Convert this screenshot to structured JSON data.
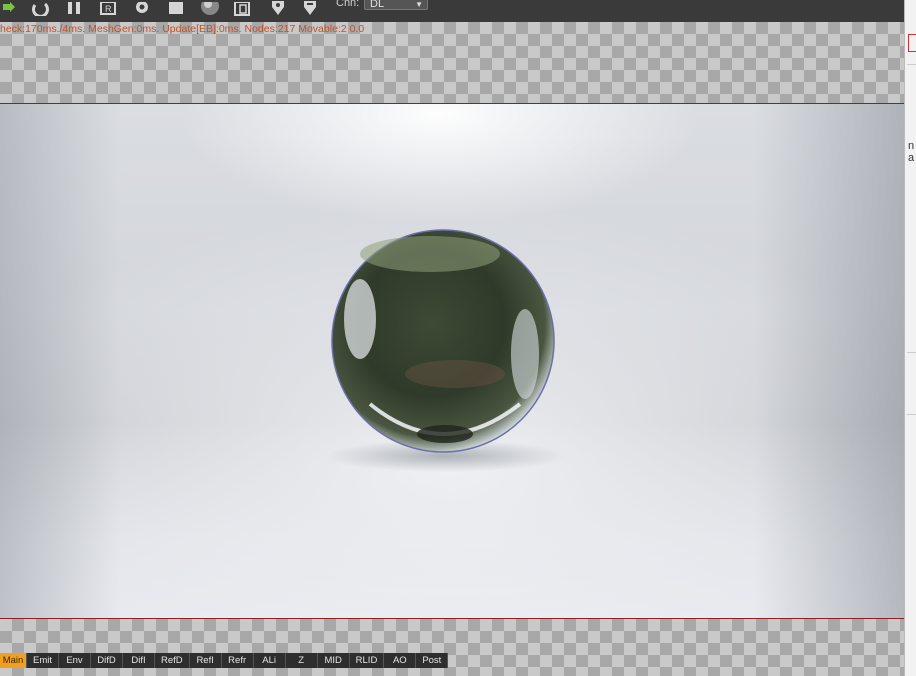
{
  "toolbar": {
    "icons": [
      "refresh-icon",
      "reload-icon",
      "pause-icon",
      "region-icon",
      "settings-icon",
      "stop-icon",
      "material-ball-icon",
      "clipboard-icon",
      "pin-icon",
      "pin-alt-icon"
    ],
    "channel_label": "Chn:",
    "channel_value": "DL"
  },
  "status": {
    "text": "heck:170ms./4ms. MeshGen:0ms. Update[EB]:0ms. Nodes:217 Movable:2  0.0"
  },
  "right_panel": {
    "partial_text": "n a"
  },
  "tabs": [
    {
      "label": "Main",
      "active": true
    },
    {
      "label": "Emit",
      "active": false
    },
    {
      "label": "Env",
      "active": false
    },
    {
      "label": "DifD",
      "active": false
    },
    {
      "label": "DifI",
      "active": false
    },
    {
      "label": "RefD",
      "active": false
    },
    {
      "label": "RefI",
      "active": false
    },
    {
      "label": "Refr",
      "active": false
    },
    {
      "label": "ALi",
      "active": false
    },
    {
      "label": "Z",
      "active": false
    },
    {
      "label": "MID",
      "active": false
    },
    {
      "label": "RLID",
      "active": false
    },
    {
      "label": "AO",
      "active": false
    },
    {
      "label": "Post",
      "active": false
    }
  ],
  "colors": {
    "active_tab": "#f0a01e",
    "status_text": "#c0522a",
    "region_border": "#8a1f25"
  }
}
